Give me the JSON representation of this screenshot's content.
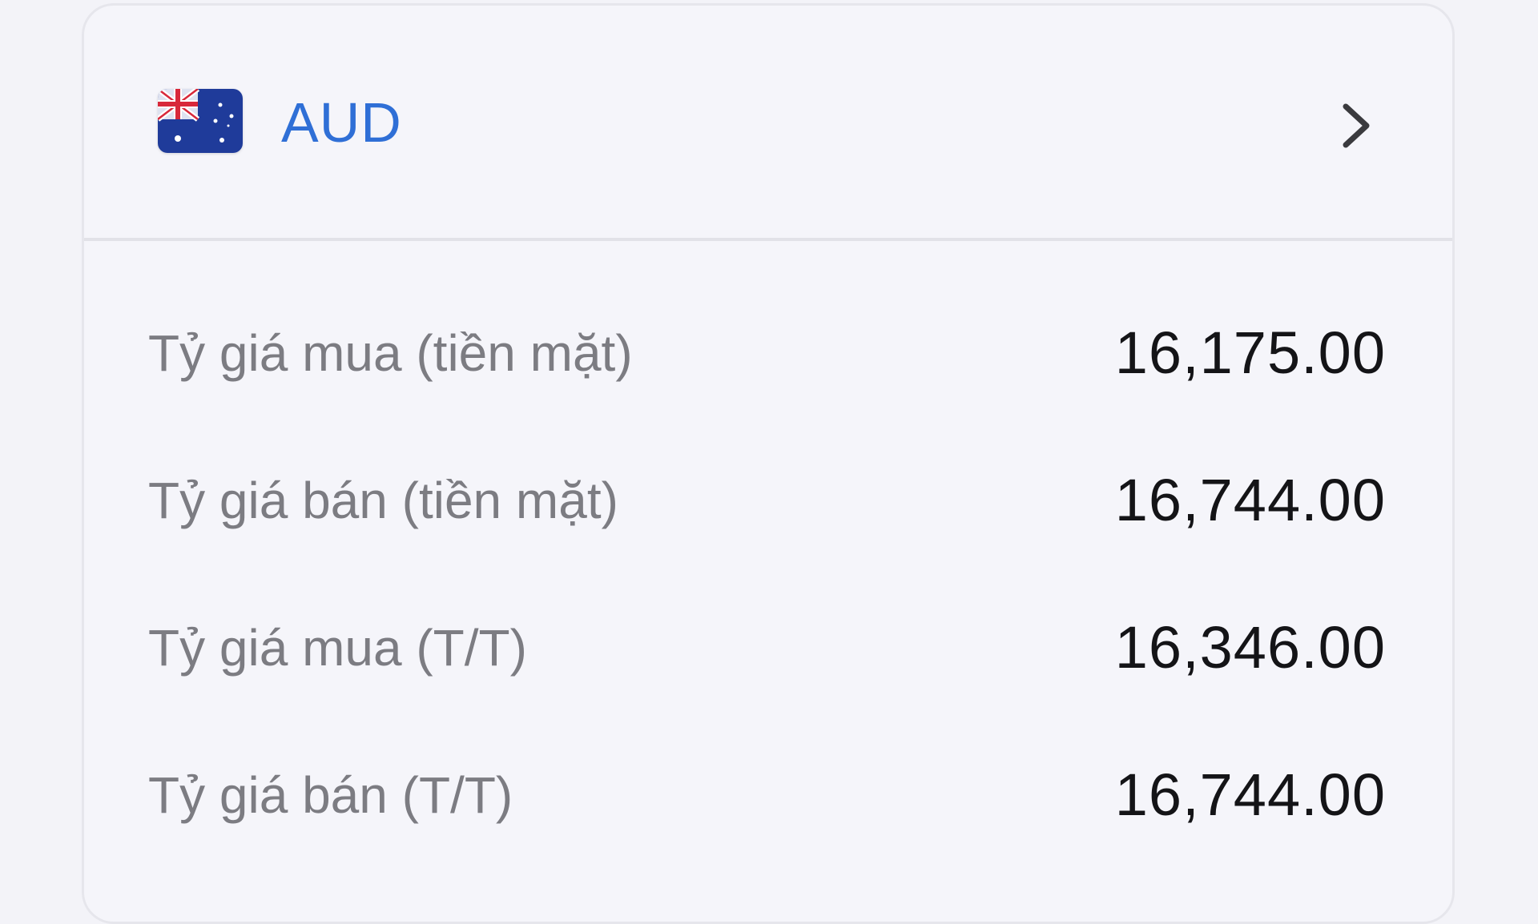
{
  "currency": {
    "code": "AUD",
    "flag_icon": "australia-flag-icon",
    "detail_icon": "chevron-right-icon",
    "accent_color": "#2f6fd6"
  },
  "rates": [
    {
      "label": "Tỷ giá mua (tiền mặt)",
      "value": "16,175.00"
    },
    {
      "label": "Tỷ giá bán (tiền mặt)",
      "value": "16,744.00"
    },
    {
      "label": "Tỷ giá mua (T/T)",
      "value": "16,346.00"
    },
    {
      "label": "Tỷ giá bán (T/T)",
      "value": "16,744.00"
    }
  ]
}
